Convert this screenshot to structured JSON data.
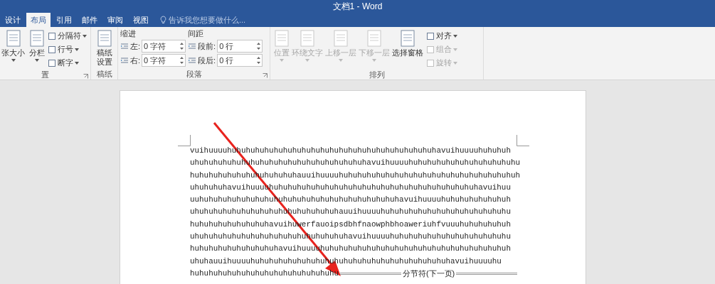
{
  "window": {
    "title": "文档1 - Word"
  },
  "tabs": [
    {
      "label": "设计",
      "selected": false
    },
    {
      "label": "布局",
      "selected": true
    },
    {
      "label": "引用",
      "selected": false
    },
    {
      "label": "邮件",
      "selected": false
    },
    {
      "label": "审阅",
      "selected": false
    },
    {
      "label": "视图",
      "selected": false
    }
  ],
  "tell_me": {
    "placeholder": "告诉我您想要做什么..."
  },
  "ribbon": {
    "page_setup": {
      "label": "置",
      "large": [
        {
          "label": "张大小"
        },
        {
          "label": "分栏"
        }
      ],
      "small": [
        {
          "label": "分隔符"
        },
        {
          "label": "行号"
        },
        {
          "label": "断字"
        }
      ]
    },
    "manuscript": {
      "label": "稿纸",
      "button": "稿纸设置"
    },
    "paragraph": {
      "label": "段落",
      "indent_title": "缩进",
      "spacing_title": "间距",
      "indent": [
        {
          "label": "左:",
          "value": "0 字符"
        },
        {
          "label": "右:",
          "value": "0 字符"
        }
      ],
      "spacing": [
        {
          "label": "段前:",
          "value": "0 行"
        },
        {
          "label": "段后:",
          "value": "0 行"
        }
      ]
    },
    "arrange": {
      "label": "排列",
      "large": [
        {
          "label": "位置",
          "disabled": true,
          "dropdown": true
        },
        {
          "label": "环绕文字",
          "disabled": true,
          "dropdown": true
        },
        {
          "label": "上移一层",
          "disabled": true,
          "dropdown": true
        },
        {
          "label": "下移一层",
          "disabled": true,
          "dropdown": true
        },
        {
          "label": "选择窗格",
          "disabled": false,
          "dropdown": false
        }
      ],
      "small": [
        {
          "label": "对齐",
          "disabled": false
        },
        {
          "label": "组合",
          "disabled": true
        },
        {
          "label": "旋转",
          "disabled": true
        }
      ]
    }
  },
  "document": {
    "lines": [
      "vuihuuuuhuhuhuhuhuhuhuhuhuhuhuhuhuhuhuhuhuhuhuhuhuhuhavuihuuuuhuhuhuh",
      "uhuhuhuhuhuhuhuhuhuhuhuhuhuhuhuhuhuhuhavuihuuuuhuhuhuhuhuhuhuhuhuhuhuhu",
      "huhuhuhuhuhuhuhuhuhuhuhauuihuuuuhuhuhuhuhuhuhuhuhuhuhuhuhuhuhuhuhuhuhuh",
      "uhuhuhuhavuihuuuuhuhuhuhuhuhuhuhuhuhuhuhuhuhuhuhuhuhuhuhuhuhuhavuihuu",
      "uuhuhuhuhuhuhuhuhuhuhuhuhuhuhuhuhuhuhuhuhuhuhavuihuuuuhuhuhuhuhuhuhuh",
      "uhuhuhuhuhuhuhuhuhuhuhuhuhuhuhuhauuihuuuuhuhuhuhuhuhuhuhuhuhuhuhuhuhu",
      "huhuhuhuhuhuhuhuhavuihuwerfauoipsdbhfnaowphbhoaweriuhfvuuuhuhuhuhuhuh",
      "uhuhuhuhuhuhuhuhuhuhuhuhuhuhuhuhuhavuihuuuuhuhuhuhuhuhuhuhuhuhuhuhuhu",
      "huhuhuhuhuhuhuhuhuhavuihuuuuhuhuhuhuhuhuhuhuhuhuhuhuhuhuhuhuhuhuhuhuh",
      "uhuhauuihuuuuhuhuhuhuhuhuhuhuhuhuhuhuhuhuhuhuhuhuhuhuhuhavuihuuuuhu",
      "huhuhuhuhuhuhuhuhuhuhuhuhuhuhuhu"
    ],
    "section_break": "分节符(下一页)"
  }
}
